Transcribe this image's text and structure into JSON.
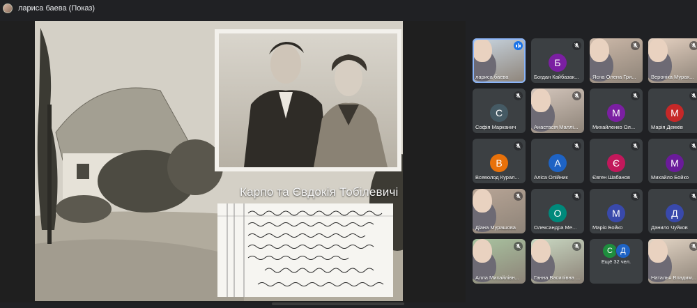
{
  "header": {
    "presenter_title": "лариса баева (Показ)"
  },
  "slide": {
    "caption": "Карпо та Євдокія Тобілевичі"
  },
  "participants": [
    {
      "name": "лариса баева",
      "initial": "",
      "color": "#c9d6e2",
      "video": true,
      "speaking": true
    },
    {
      "name": "Богдан Кайбазак...",
      "initial": "Б",
      "color": "#7b1fa2",
      "video": false
    },
    {
      "name": "Ясна Олена Гри...",
      "initial": "",
      "color": "#cdb9a9",
      "video": true
    },
    {
      "name": "Вероніка Мурах...",
      "initial": "",
      "color": "#e6d2c2",
      "video": true
    },
    {
      "name": "Софія Марканич",
      "initial": "С",
      "color": "#455a64",
      "video": false
    },
    {
      "name": "Анастасія Маллі...",
      "initial": "",
      "color": "#d4c6bc",
      "video": true
    },
    {
      "name": "Михайленко Ол...",
      "initial": "М",
      "color": "#7b1fa2",
      "video": false
    },
    {
      "name": "Марія Демків",
      "initial": "М",
      "color": "#c62828",
      "video": false
    },
    {
      "name": "Всеволод Курал...",
      "initial": "В",
      "color": "#e8710a",
      "video": false
    },
    {
      "name": "Аліса Олійник",
      "initial": "А",
      "color": "#1e63c4",
      "video": false
    },
    {
      "name": "Євген Шабанов",
      "initial": "Є",
      "color": "#c2185b",
      "video": false
    },
    {
      "name": "Михайло Бойко",
      "initial": "М",
      "color": "#6a1b9a",
      "video": false
    },
    {
      "name": "Діана Мурашова",
      "initial": "",
      "color": "#b8a596",
      "video": true
    },
    {
      "name": "Олександра Ме...",
      "initial": "О",
      "color": "#00897b",
      "video": false
    },
    {
      "name": "Марія Бойко",
      "initial": "М",
      "color": "#3949ab",
      "video": false
    },
    {
      "name": "Данило Чуйков",
      "initial": "Д",
      "color": "#3949ab",
      "video": false
    },
    {
      "name": "Алла Михайлівн...",
      "initial": "",
      "color": "#a9c3a0",
      "video": true
    },
    {
      "name": "Ганна Василівна ...",
      "initial": "",
      "color": "#c9d8c2",
      "video": true
    },
    {
      "name": "Наталья Владим...",
      "initial": "",
      "color": "#e4d6c6",
      "video": true
    }
  ],
  "more": {
    "label": "Ещё 32 чел.",
    "initials": [
      "С",
      "Д"
    ],
    "colors": [
      "#1e8e3e",
      "#1e63c4"
    ]
  },
  "icons": {
    "mute": "mic-off-icon",
    "speaking": "audio-level-icon"
  }
}
